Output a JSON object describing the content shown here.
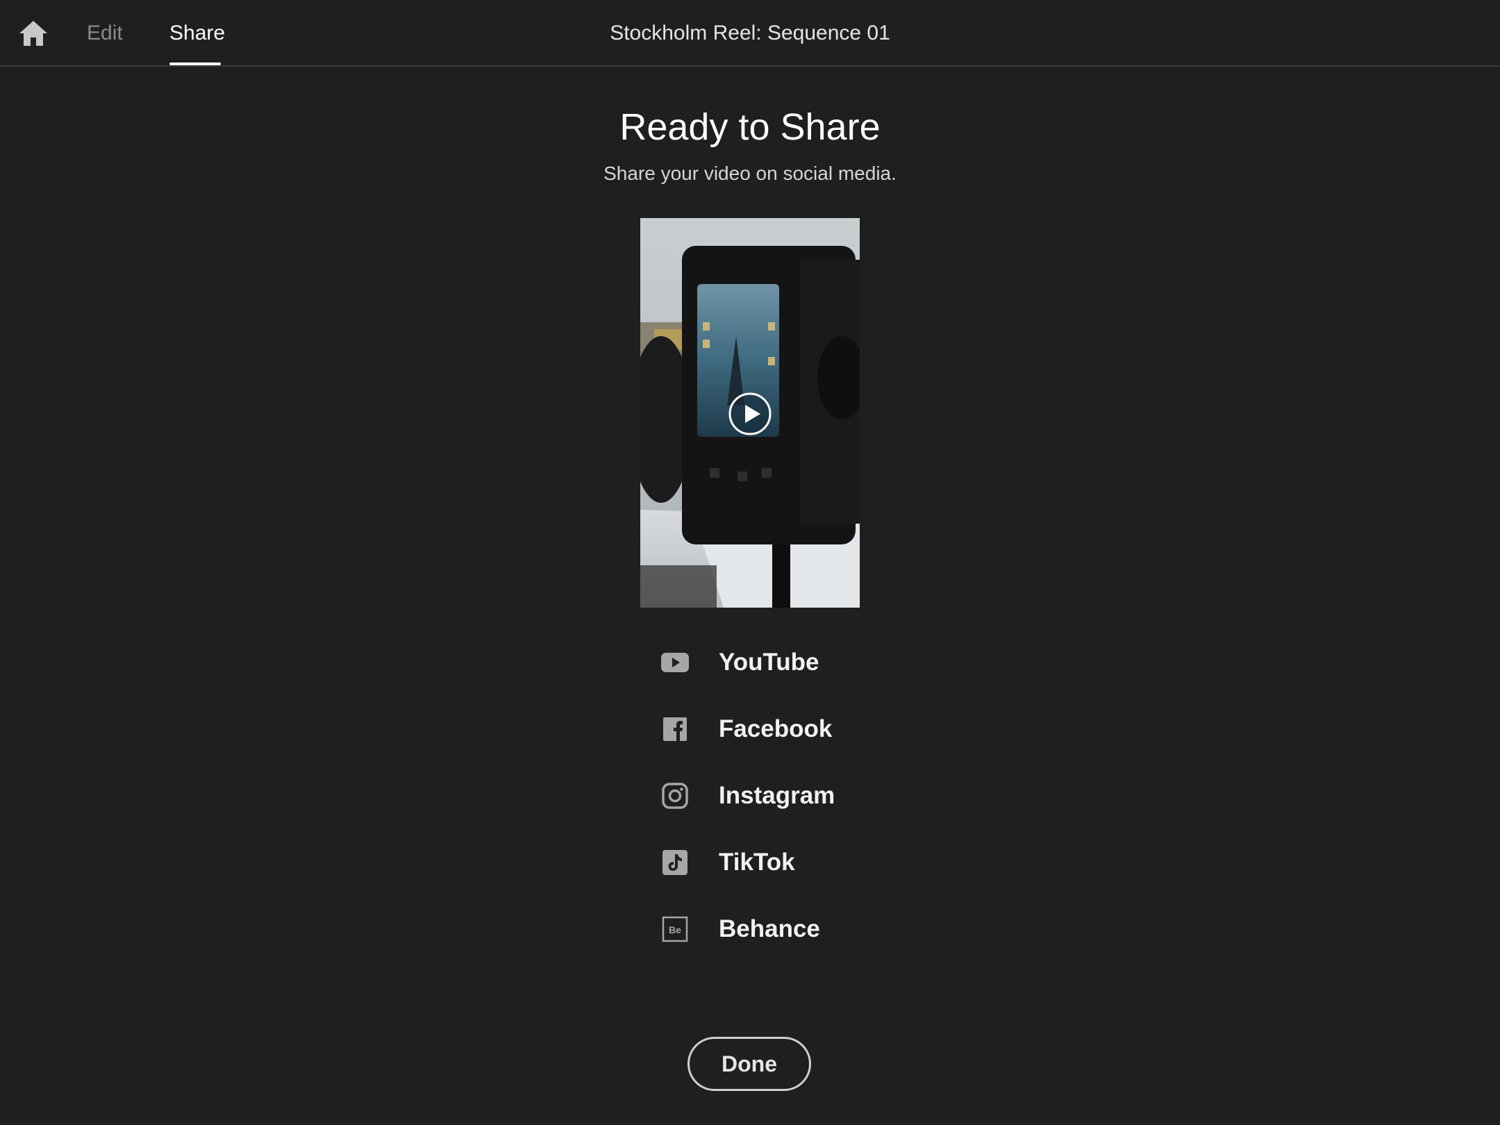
{
  "topbar": {
    "tabs": [
      {
        "label": "Edit",
        "active": false
      },
      {
        "label": "Share",
        "active": true
      }
    ],
    "project_title": "Stockholm Reel: Sequence 01",
    "home_icon": "home-icon"
  },
  "main": {
    "heading": "Ready to Share",
    "subheading": "Share your video on social media.",
    "preview": {
      "play_icon": "play-icon"
    },
    "share_options": [
      {
        "label": "YouTube",
        "icon": "youtube-icon"
      },
      {
        "label": "Facebook",
        "icon": "facebook-icon"
      },
      {
        "label": "Instagram",
        "icon": "instagram-icon"
      },
      {
        "label": "TikTok",
        "icon": "tiktok-icon"
      },
      {
        "label": "Behance",
        "icon": "behance-icon"
      }
    ],
    "done_label": "Done"
  },
  "colors": {
    "background": "#1f1f1f",
    "text_primary": "#ffffff",
    "text_muted": "#8a8a8a",
    "icon_gray": "#a6a6a6"
  }
}
